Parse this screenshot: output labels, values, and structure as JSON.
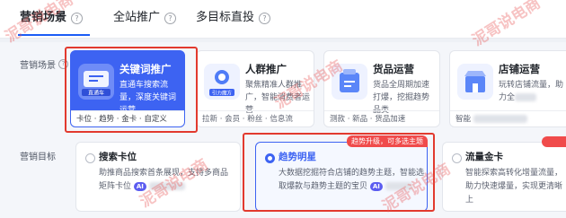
{
  "tabs": [
    {
      "label": "营销场景",
      "active": true
    },
    {
      "label": "全站推广",
      "active": false
    },
    {
      "label": "多目标直投",
      "active": false
    }
  ],
  "rows": {
    "scene_label": "营销场景",
    "goal_label": "营销目标"
  },
  "scenes": [
    {
      "title": "关键词推广",
      "desc": "直通车搜索流量，深度关键词运营",
      "icon_label": "直通车",
      "footer": "卡位 · 趋势 · 金卡 · 自定义",
      "selected": true
    },
    {
      "title": "人群推广",
      "desc": "聚焦精准人群推广，智能消费者运营",
      "icon_label": "引力魔方",
      "footer": "拉新 · 会员 · 粉丝 · 信息流",
      "selected": false
    },
    {
      "title": "货品运营",
      "desc": "货品全周期加速打爆，挖掘趋势品类",
      "footer": "测款 · 新品 · 货品加速",
      "selected": false
    },
    {
      "title": "店铺运营",
      "desc": "玩转店铺流量，助力全",
      "footer": "智能",
      "selected": false
    }
  ],
  "goals": [
    {
      "title": "搜索卡位",
      "desc": "助推商品搜索首条展现，支持多商品矩阵卡位",
      "selected": false
    },
    {
      "title": "趋势明星",
      "desc": "大数据挖掘符合店铺的趋势主题，智能选取爆款与趋势主题的宝贝",
      "badge": "趋势升级，可多选主题",
      "selected": true
    },
    {
      "title": "流量金卡",
      "desc": "智能探索高转化增量流量，助力快速爆量，实现更清晰上",
      "selected": false
    }
  ],
  "ai_badge": "AI",
  "watermark": "泥哥说电商",
  "colors": {
    "primary": "#3d63f2",
    "highlight": "#e23a2e",
    "badge": "#f04b4b"
  }
}
